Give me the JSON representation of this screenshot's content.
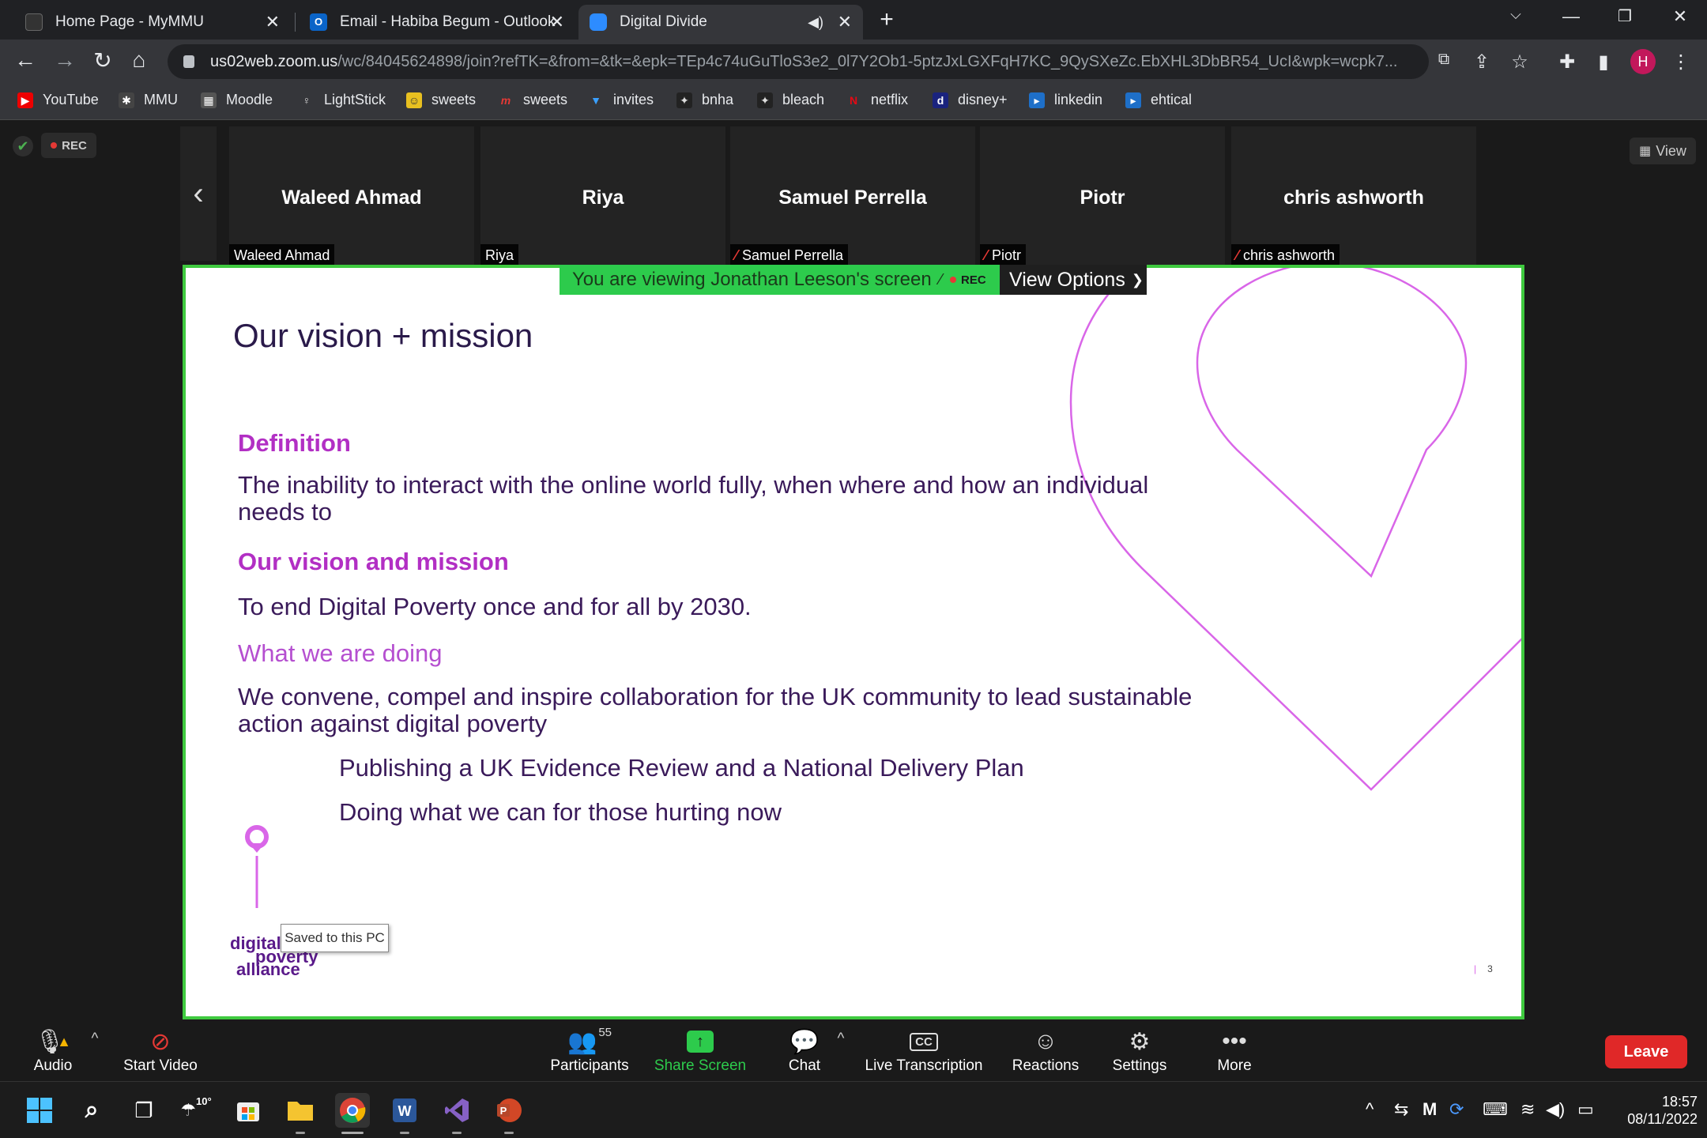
{
  "browser": {
    "tabs": [
      {
        "title": "Home Page - MyMMU",
        "active": false
      },
      {
        "title": "Email - Habiba Begum - Outlook",
        "active": false
      },
      {
        "title": "Digital Divide",
        "active": true
      }
    ],
    "new_tab": "+",
    "url_host": "us02web.zoom.us",
    "url_path": "/wc/84045624898/join?refTK=&from=&tk=&epk=TEp4c74uGuTloS3e2_0l7Y2Ob1-5ptzJxLGXFqH7KC_9QySXeZc.EbXHL3DbBR54_UcI&wpk=wcpk7...",
    "profile_initial": "H",
    "bookmarks": [
      "YouTube",
      "MMU",
      "Moodle",
      "LightStick",
      "sweets",
      "sweets",
      "invites",
      "bnha",
      "bleach",
      "netflix",
      "disney+",
      "linkedin",
      "ehtical"
    ]
  },
  "zoom": {
    "rec_label": "REC",
    "view_label": "View",
    "participants_strip": [
      {
        "name": "Waleed Ahmad",
        "label": "Waleed Ahmad",
        "muted": false
      },
      {
        "name": "Riya",
        "label": "Riya",
        "muted": false
      },
      {
        "name": "Samuel Perrella",
        "label": "Samuel Perrella",
        "muted": true
      },
      {
        "name": "Piotr",
        "label": "Piotr",
        "muted": true
      },
      {
        "name": "chris ashworth",
        "label": "chris ashworth",
        "muted": true
      }
    ],
    "viewing_banner": "You are viewing Jonathan Leeson's screen",
    "banner_rec": "REC",
    "view_options": "View Options",
    "controls": {
      "audio": "Audio",
      "start_video": "Start Video",
      "participants": "Participants",
      "participant_count": "55",
      "share_screen": "Share Screen",
      "chat": "Chat",
      "live_transcription": "Live Transcription",
      "cc": "CC",
      "reactions": "Reactions",
      "settings": "Settings",
      "more": "More",
      "leave": "Leave"
    }
  },
  "slide": {
    "title": "Our vision + mission",
    "definition_heading": "Definition",
    "definition_text_1": "The inability to interact with the online world fully, when where and how an individual",
    "definition_text_2": "needs to",
    "vision_heading": "Our vision and mission",
    "vision_text": "To end Digital Poverty once and for all by 2030.",
    "doing_heading": "What we are doing",
    "doing_text_1": "We convene, compel and inspire collaboration for the UK community to lead sustainable",
    "doing_text_2": "action against digital poverty",
    "bullet_1": "Publishing a UK Evidence Review and a National Delivery Plan",
    "bullet_2": "Doing what we can for those hurting now",
    "logo_line_1": "digital",
    "logo_line_2": "poverty",
    "logo_line_3": "alliance",
    "saved_tooltip": "Saved to this PC",
    "page_number": "3",
    "accent_color": "#d966e8"
  },
  "taskbar": {
    "weather": "10°",
    "time": "18:57",
    "date": "08/11/2022"
  }
}
